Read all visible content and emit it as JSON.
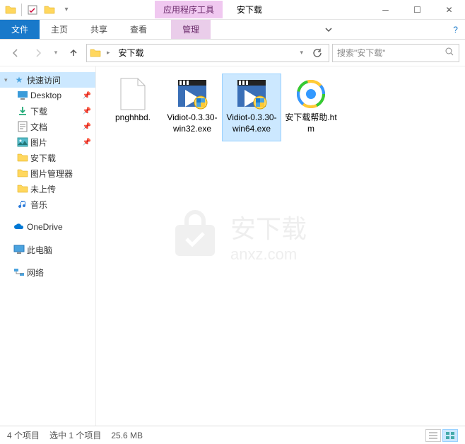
{
  "titlebar": {
    "contextual_label": "应用程序工具",
    "window_title": "安下载"
  },
  "ribbon": {
    "file": "文件",
    "tabs": [
      "主页",
      "共享",
      "查看"
    ],
    "context_tab": "管理"
  },
  "address": {
    "current": "安下载",
    "search_placeholder": "搜索\"安下载\""
  },
  "nav": {
    "quick_access": "快速访问",
    "quick_items": [
      {
        "label": "Desktop",
        "pinned": true,
        "icon": "desktop"
      },
      {
        "label": "下载",
        "pinned": true,
        "icon": "download"
      },
      {
        "label": "文档",
        "pinned": true,
        "icon": "doc"
      },
      {
        "label": "图片",
        "pinned": true,
        "icon": "pic"
      },
      {
        "label": "安下载",
        "pinned": false,
        "icon": "folder"
      },
      {
        "label": "图片管理器",
        "pinned": false,
        "icon": "folder"
      },
      {
        "label": "未上传",
        "pinned": false,
        "icon": "folder"
      },
      {
        "label": "音乐",
        "pinned": false,
        "icon": "music"
      }
    ],
    "onedrive": "OneDrive",
    "this_pc": "此电脑",
    "network": "网络"
  },
  "files": [
    {
      "name": "pnghhbd.",
      "type": "blank",
      "selected": false
    },
    {
      "name": "Vidiot-0.3.30-win32.exe",
      "type": "exe",
      "selected": false
    },
    {
      "name": "Vidiot-0.3.30-win64.exe",
      "type": "exe",
      "selected": true
    },
    {
      "name": "安下载帮助.htm",
      "type": "htm",
      "selected": false
    }
  ],
  "status": {
    "count": "4 个项目",
    "selection": "选中 1 个项目",
    "size": "25.6 MB"
  },
  "watermark": {
    "text": "安下载",
    "sub": "anxz.com"
  }
}
